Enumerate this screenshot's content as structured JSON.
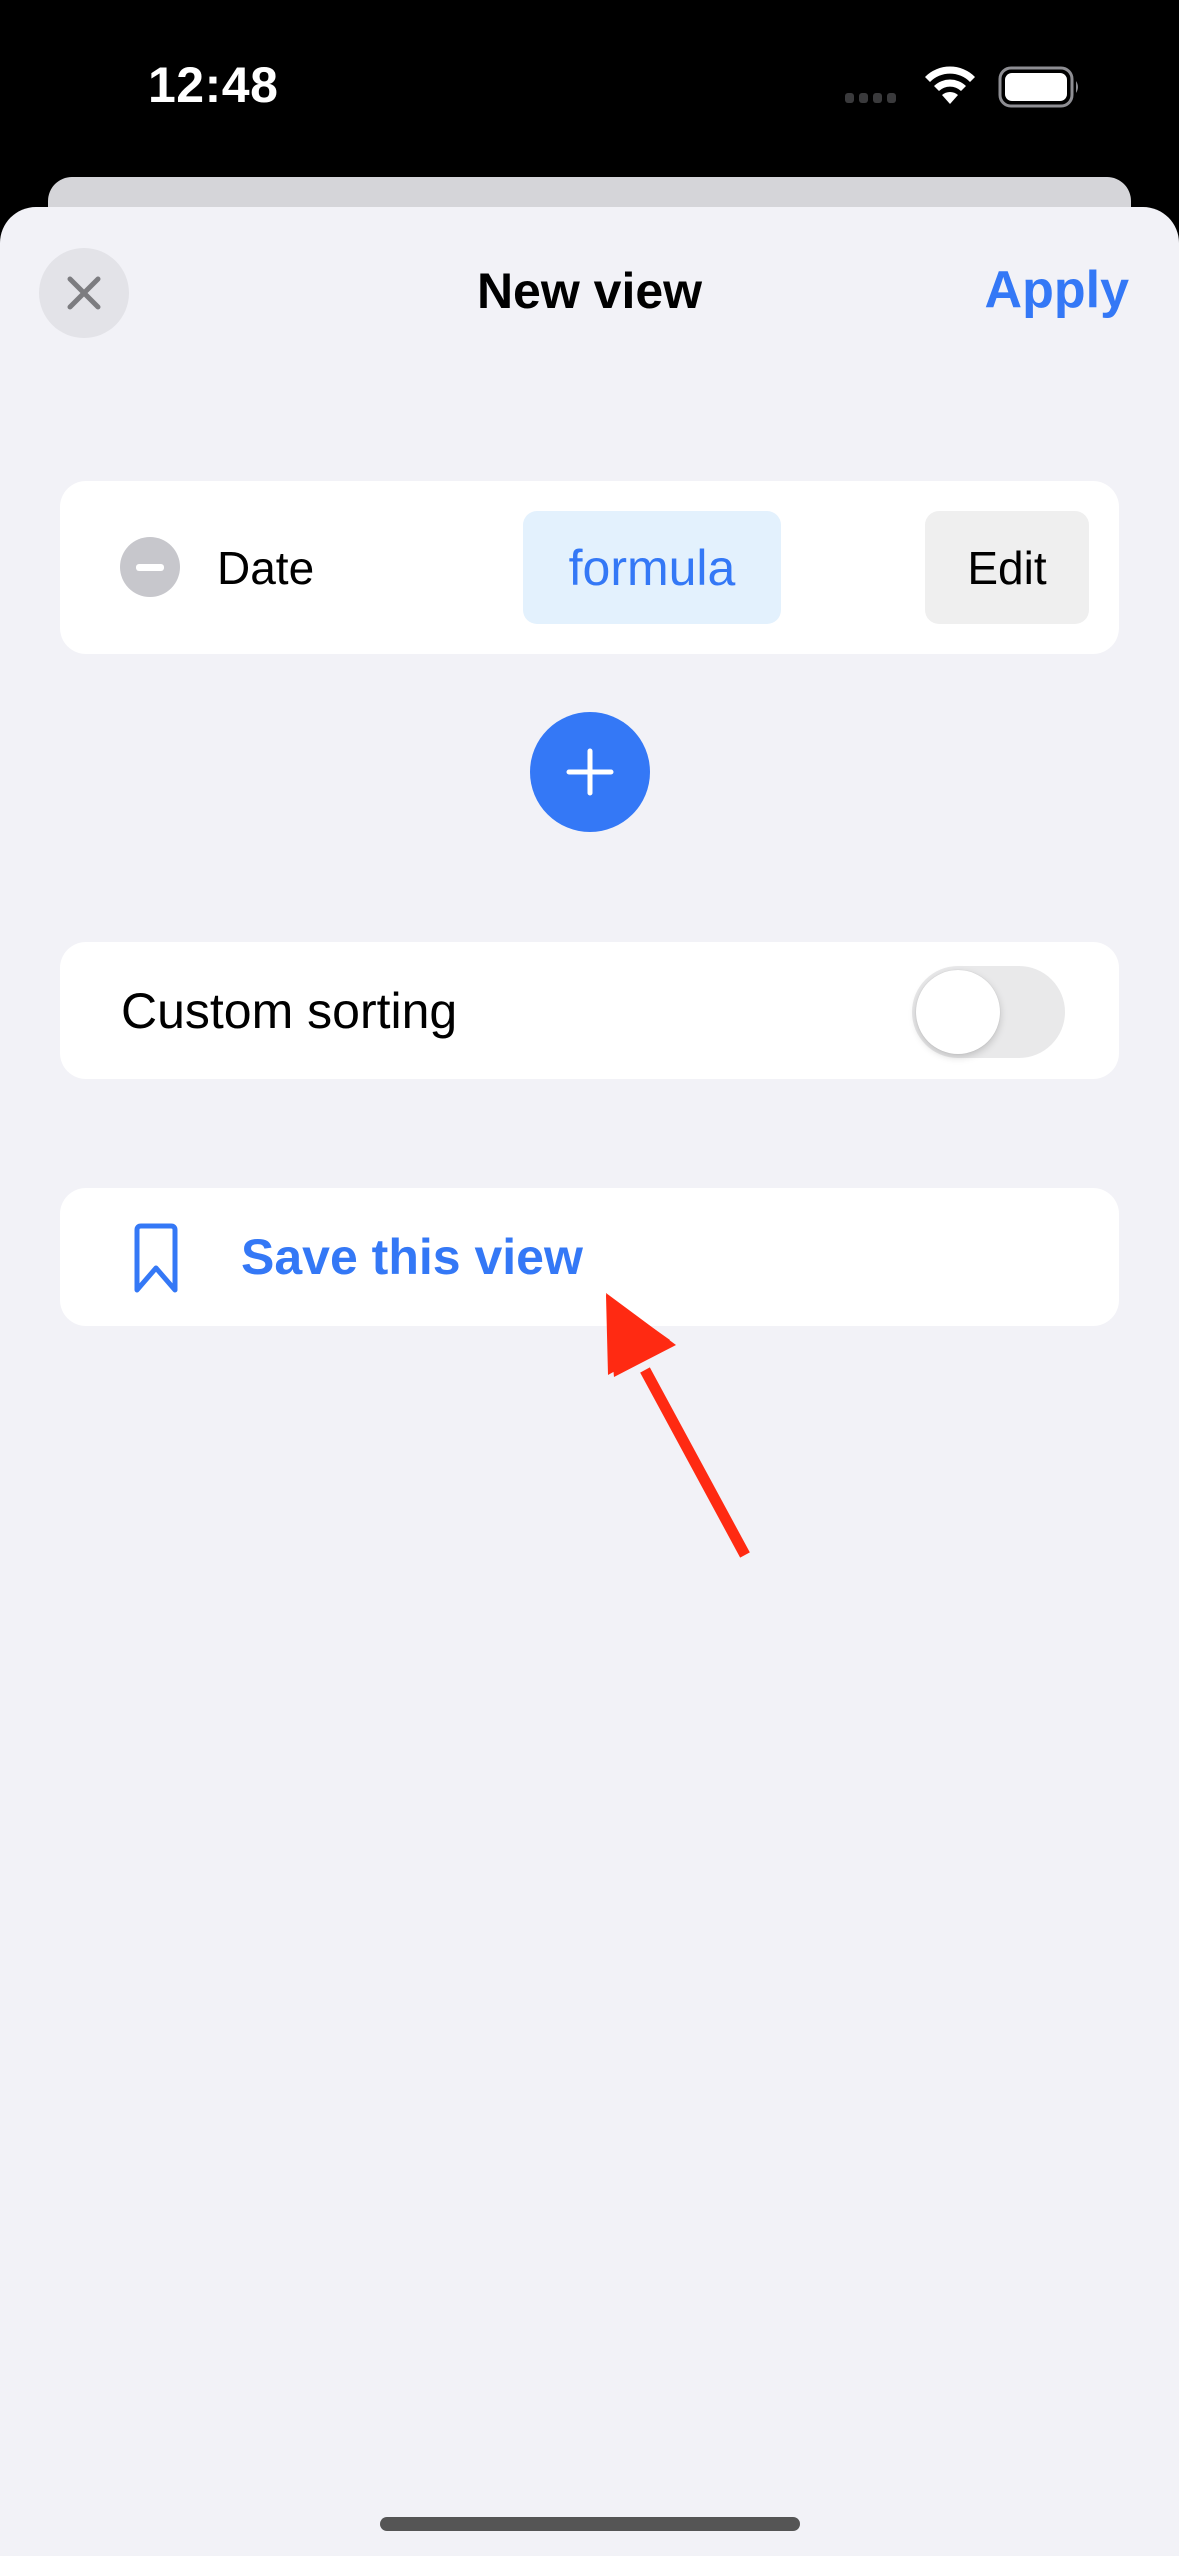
{
  "status_bar": {
    "time": "12:48",
    "icons": [
      "cellular-signal-icon",
      "wifi-icon",
      "battery-icon"
    ]
  },
  "header": {
    "close_icon": "close-x-icon",
    "title": "New view",
    "apply_label": "Apply"
  },
  "filters": [
    {
      "remove_icon": "minus-circle-icon",
      "field": "Date",
      "value_chip": "formula",
      "edit_label": "Edit"
    }
  ],
  "add_filter_icon": "plus-circle-icon",
  "custom_sorting": {
    "label": "Custom sorting",
    "enabled": false
  },
  "save_view": {
    "icon": "bookmark-icon",
    "label": "Save this view"
  },
  "annotation": {
    "type": "red-arrow",
    "color": "#ff2a12",
    "points_to": "save-this-view"
  },
  "colors": {
    "accent": "#3478f6",
    "sheet_background": "#f2f2f7",
    "card_background": "#ffffff",
    "chip_background": "#e3f1fd"
  }
}
